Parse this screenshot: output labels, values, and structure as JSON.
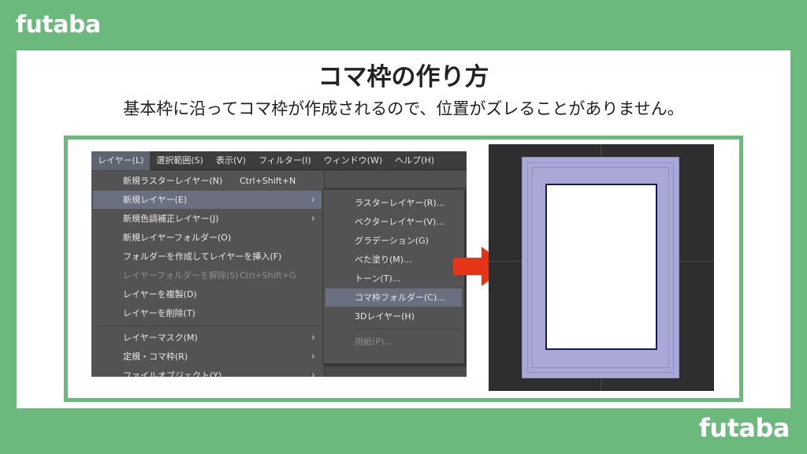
{
  "brand": {
    "logo_text": "futaba"
  },
  "header": {
    "title": "コマ枠の作り方",
    "subtitle": "基本枠に沿ってコマ枠が作成されるので、位置がズレることがありません。"
  },
  "menubar": {
    "items": [
      {
        "label": "レイヤー(L)",
        "active": true
      },
      {
        "label": "選択範囲(S)"
      },
      {
        "label": "表示(V)"
      },
      {
        "label": "フィルター(I)"
      },
      {
        "label": "ウィンドウ(W)"
      },
      {
        "label": "ヘルプ(H)"
      }
    ]
  },
  "layer_menu": {
    "items": [
      {
        "label": "新規ラスターレイヤー(N)",
        "shortcut": "Ctrl+Shift+N"
      },
      {
        "label": "新規レイヤー(E)",
        "submenu": true,
        "highlighted": true
      },
      {
        "label": "新規色調補正レイヤー(J)",
        "submenu": true
      },
      {
        "label": "新規レイヤーフォルダー(O)"
      },
      {
        "label": "フォルダーを作成してレイヤーを挿入(F)"
      },
      {
        "label": "レイヤーフォルダーを解除(S)",
        "shortcut": "Ctrl+Shift+G",
        "disabled": true
      },
      {
        "label": "レイヤーを複製(D)"
      },
      {
        "label": "レイヤーを削除(T)"
      },
      {
        "label": "レイヤーマスク(M)",
        "submenu": true
      },
      {
        "label": "定規・コマ枠(R)",
        "submenu": true
      },
      {
        "label": "ファイルオブジェクト(Y)",
        "submenu": true
      }
    ]
  },
  "new_layer_submenu": {
    "items": [
      {
        "label": "ラスターレイヤー(R)..."
      },
      {
        "label": "ベクターレイヤー(V)..."
      },
      {
        "label": "グラデーション(G)"
      },
      {
        "label": "べた塗り(M)..."
      },
      {
        "label": "トーン(T)..."
      },
      {
        "label": "コマ枠フォルダー(C)...",
        "highlighted": true
      },
      {
        "label": "3Dレイヤー(H)"
      },
      {
        "label": "用紙(P)...",
        "disabled": true
      }
    ]
  },
  "colors": {
    "background_green": "#6bb97c",
    "arrow_red": "#e53418",
    "frame_purple": "#a9a8d6",
    "koma_border": "#1a1a5a"
  },
  "icons": {
    "arrow": "right-arrow-icon",
    "submenu": "chevron-right-icon"
  }
}
